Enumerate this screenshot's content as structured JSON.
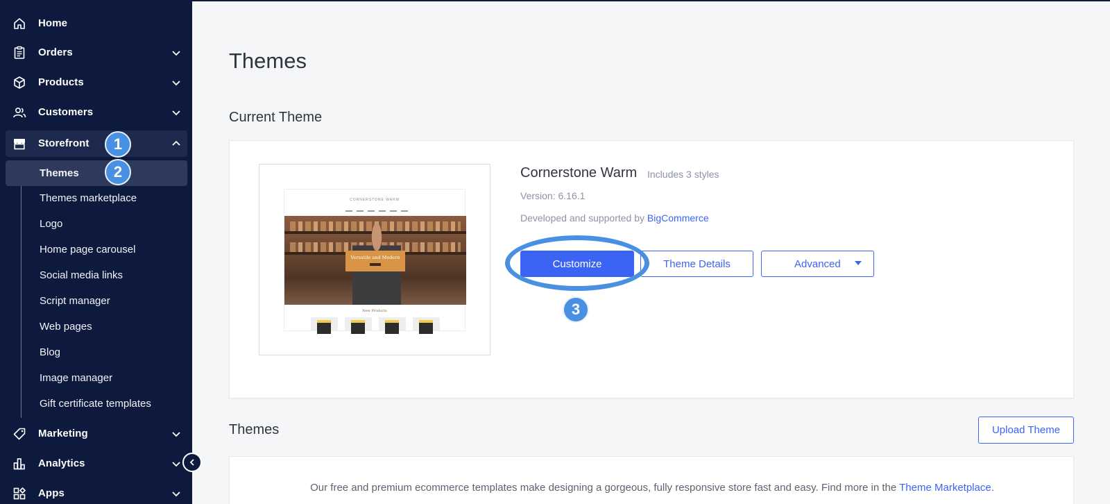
{
  "sidebar": {
    "items": [
      {
        "label": "Home",
        "icon": "home-icon"
      },
      {
        "label": "Orders",
        "icon": "orders-icon"
      },
      {
        "label": "Products",
        "icon": "products-icon"
      },
      {
        "label": "Customers",
        "icon": "customers-icon"
      },
      {
        "label": "Storefront",
        "icon": "storefront-icon"
      },
      {
        "label": "Marketing",
        "icon": "marketing-icon"
      },
      {
        "label": "Analytics",
        "icon": "analytics-icon"
      },
      {
        "label": "Apps",
        "icon": "apps-icon"
      }
    ],
    "storefront_sub": [
      "Themes",
      "Themes marketplace",
      "Logo",
      "Home page carousel",
      "Social media links",
      "Script manager",
      "Web pages",
      "Blog",
      "Image manager",
      "Gift certificate templates"
    ]
  },
  "steps": [
    "1",
    "2",
    "3"
  ],
  "main": {
    "page_title": "Themes",
    "current_theme_heading": "Current Theme",
    "current_theme": {
      "name": "Cornerstone Warm",
      "styles": "Includes 3 styles",
      "version": "Version: 6.16.1",
      "developed_prefix": "Developed and supported by ",
      "developer": "BigCommerce",
      "preview": {
        "logo": "CORNERSTONE WARM",
        "banner": "Versatile and Modern",
        "new_products": "New Products"
      }
    },
    "buttons": {
      "customize": "Customize",
      "theme_details": "Theme Details",
      "advanced": "Advanced",
      "upload_theme": "Upload Theme"
    },
    "themes_heading": "Themes",
    "themes_desc_prefix": "Our free and premium ecommerce templates make designing a gorgeous, fully responsive store fast and easy. Find more in the ",
    "themes_desc_link": "Theme Marketplace",
    "themes_desc_suffix": "."
  },
  "colors": {
    "sidebar_bg": "#0d1a3d",
    "accent": "#3c64f4",
    "step_badge": "#4a90e2"
  }
}
